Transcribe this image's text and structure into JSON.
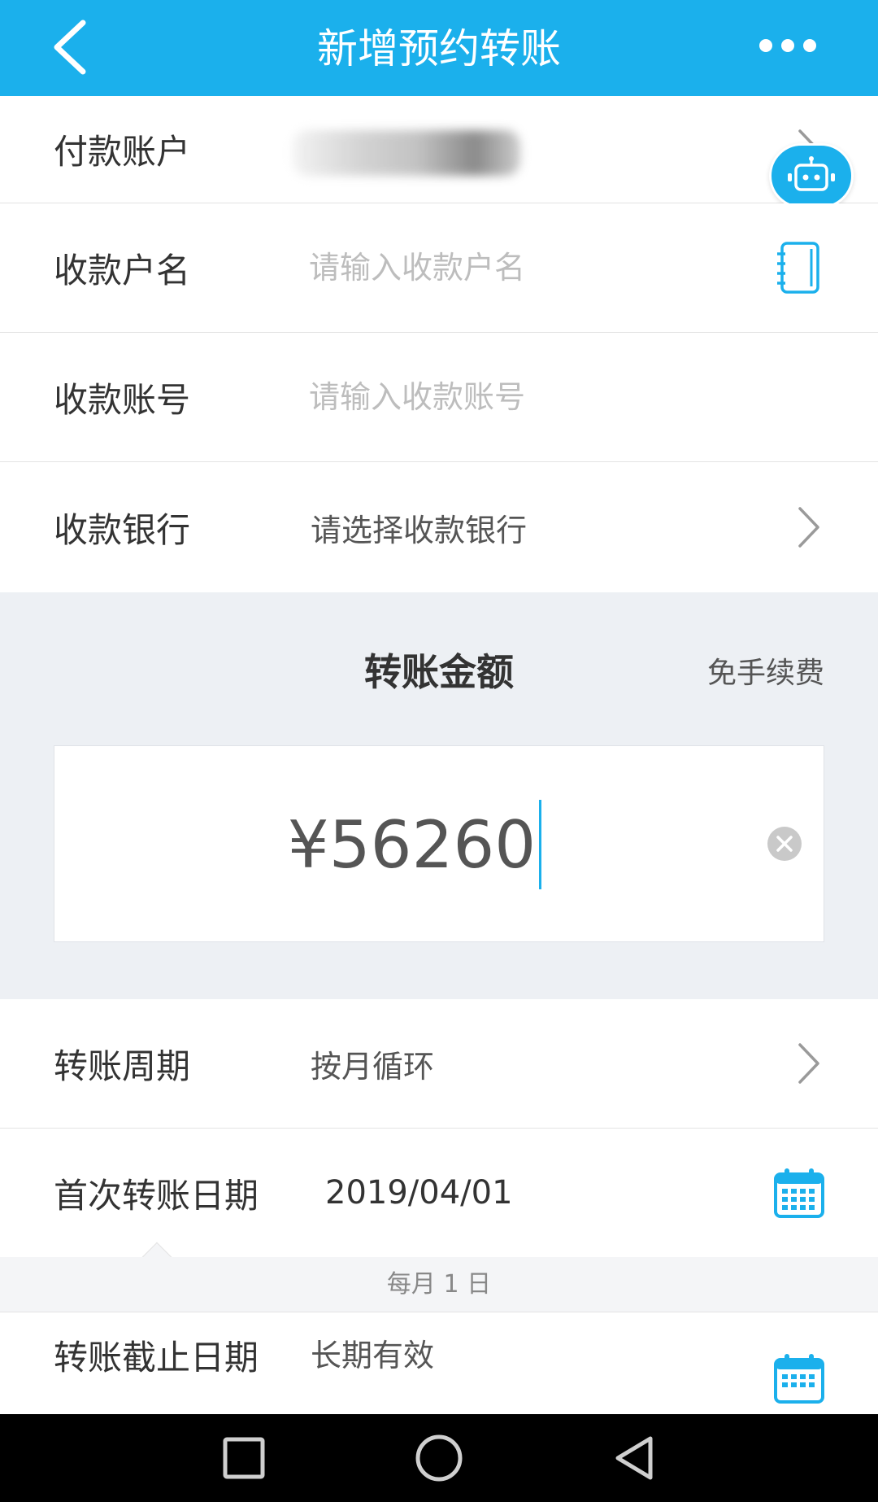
{
  "header": {
    "title": "新增预约转账",
    "back_icon": "chevron-left-icon",
    "more_icon": "more-dots-icon"
  },
  "colors": {
    "accent": "#1bb0ec",
    "section_bg": "#edf0f4",
    "text": "#333333",
    "placeholder": "#bdbdbd"
  },
  "form": {
    "payer_account": {
      "label": "付款账户"
    },
    "payee_name": {
      "label": "收款户名",
      "placeholder": "请输入收款户名",
      "value": ""
    },
    "payee_account": {
      "label": "收款账号",
      "placeholder": "请输入收款账号",
      "value": ""
    },
    "payee_bank": {
      "label": "收款银行",
      "value": "请选择收款银行"
    }
  },
  "amount": {
    "title": "转账金额",
    "fee_note": "免手续费",
    "value": "¥56260"
  },
  "schedule": {
    "cycle": {
      "label": "转账周期",
      "value": "按月循环"
    },
    "first_date": {
      "label": "首次转账日期",
      "value": "2019/04/01"
    },
    "hint": "每月 1 日",
    "end_date": {
      "label": "转账截止日期",
      "value": "长期有效"
    }
  },
  "system_nav": {
    "recent_icon": "square-recent-icon",
    "home_icon": "circle-home-icon",
    "back_icon": "triangle-back-icon"
  }
}
